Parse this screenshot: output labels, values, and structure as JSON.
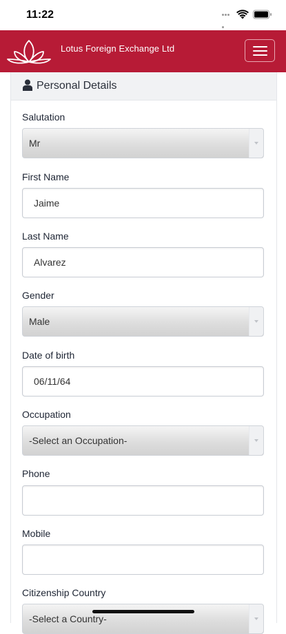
{
  "status_bar": {
    "time": "11:22"
  },
  "navbar": {
    "brand": "Lotus Foreign Exchange Ltd",
    "brand_color": "#b71b36"
  },
  "panel": {
    "title": "Personal Details"
  },
  "form": {
    "salutation": {
      "label": "Salutation",
      "value": "Mr"
    },
    "first_name": {
      "label": "First Name",
      "value": "Jaime"
    },
    "last_name": {
      "label": "Last Name",
      "value": "Alvarez"
    },
    "gender": {
      "label": "Gender",
      "value": "Male"
    },
    "date_of_birth": {
      "label": "Date of birth",
      "value": "06/11/64"
    },
    "occupation": {
      "label": "Occupation",
      "value": "-Select an Occupation-"
    },
    "phone": {
      "label": "Phone",
      "value": ""
    },
    "mobile": {
      "label": "Mobile",
      "value": ""
    },
    "citizenship_country": {
      "label": "Citizenship Country",
      "value": "-Select a Country-"
    }
  }
}
